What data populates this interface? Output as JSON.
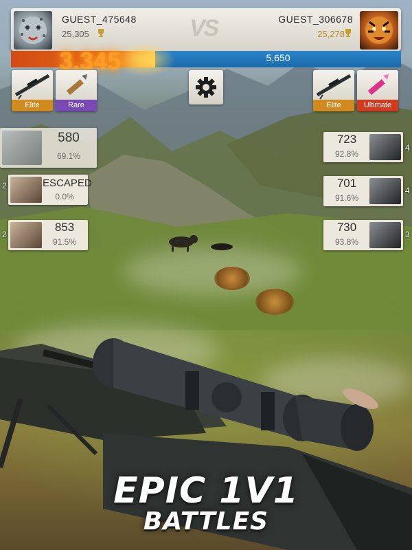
{
  "player_left": {
    "name": "GUEST_475648",
    "score": "25,305",
    "avatar": "snow-leopard-avatar"
  },
  "player_right": {
    "name": "GUEST_306678",
    "score": "25,278",
    "avatar": "tiger-avatar"
  },
  "versus": "VS",
  "match_score": {
    "left": "3,345",
    "right": "5,650",
    "left_share": 0.37
  },
  "weapons_left": [
    {
      "icon": "sniper-rifle-icon",
      "tier": "Elite"
    },
    {
      "icon": "bullet-icon",
      "tier": "Rare"
    }
  ],
  "weapons_right": [
    {
      "icon": "sniper-rifle-icon",
      "tier": "Elite"
    },
    {
      "icon": "pink-bullet-icon",
      "tier": "Ultimate"
    }
  ],
  "settings_icon": "gear-icon",
  "left_targets": [
    {
      "icon": "buffalo-icon",
      "points": "580",
      "accuracy": "69.1%",
      "count": ""
    },
    {
      "icon": "ram-icon",
      "points": "ESCAPED",
      "accuracy": "0.0%",
      "count": "2"
    },
    {
      "icon": "ram-icon",
      "points": "853",
      "accuracy": "91.5%",
      "count": "2"
    }
  ],
  "right_targets": [
    {
      "icon": "buffalo-icon",
      "points": "723",
      "accuracy": "92.8%",
      "count": "4"
    },
    {
      "icon": "buffalo-icon",
      "points": "701",
      "accuracy": "91.6%",
      "count": "4"
    },
    {
      "icon": "buffalo-icon",
      "points": "730",
      "accuracy": "93.8%",
      "count": "3"
    }
  ],
  "tagline": {
    "line1": "EPIC 1V1",
    "line2": "BATTLES"
  },
  "colors": {
    "elite": "#d18a1e",
    "rare": "#7a4ab4",
    "ultimate": "#d03a1e",
    "score_left": "#e26b16",
    "score_right": "#1b6aab"
  }
}
